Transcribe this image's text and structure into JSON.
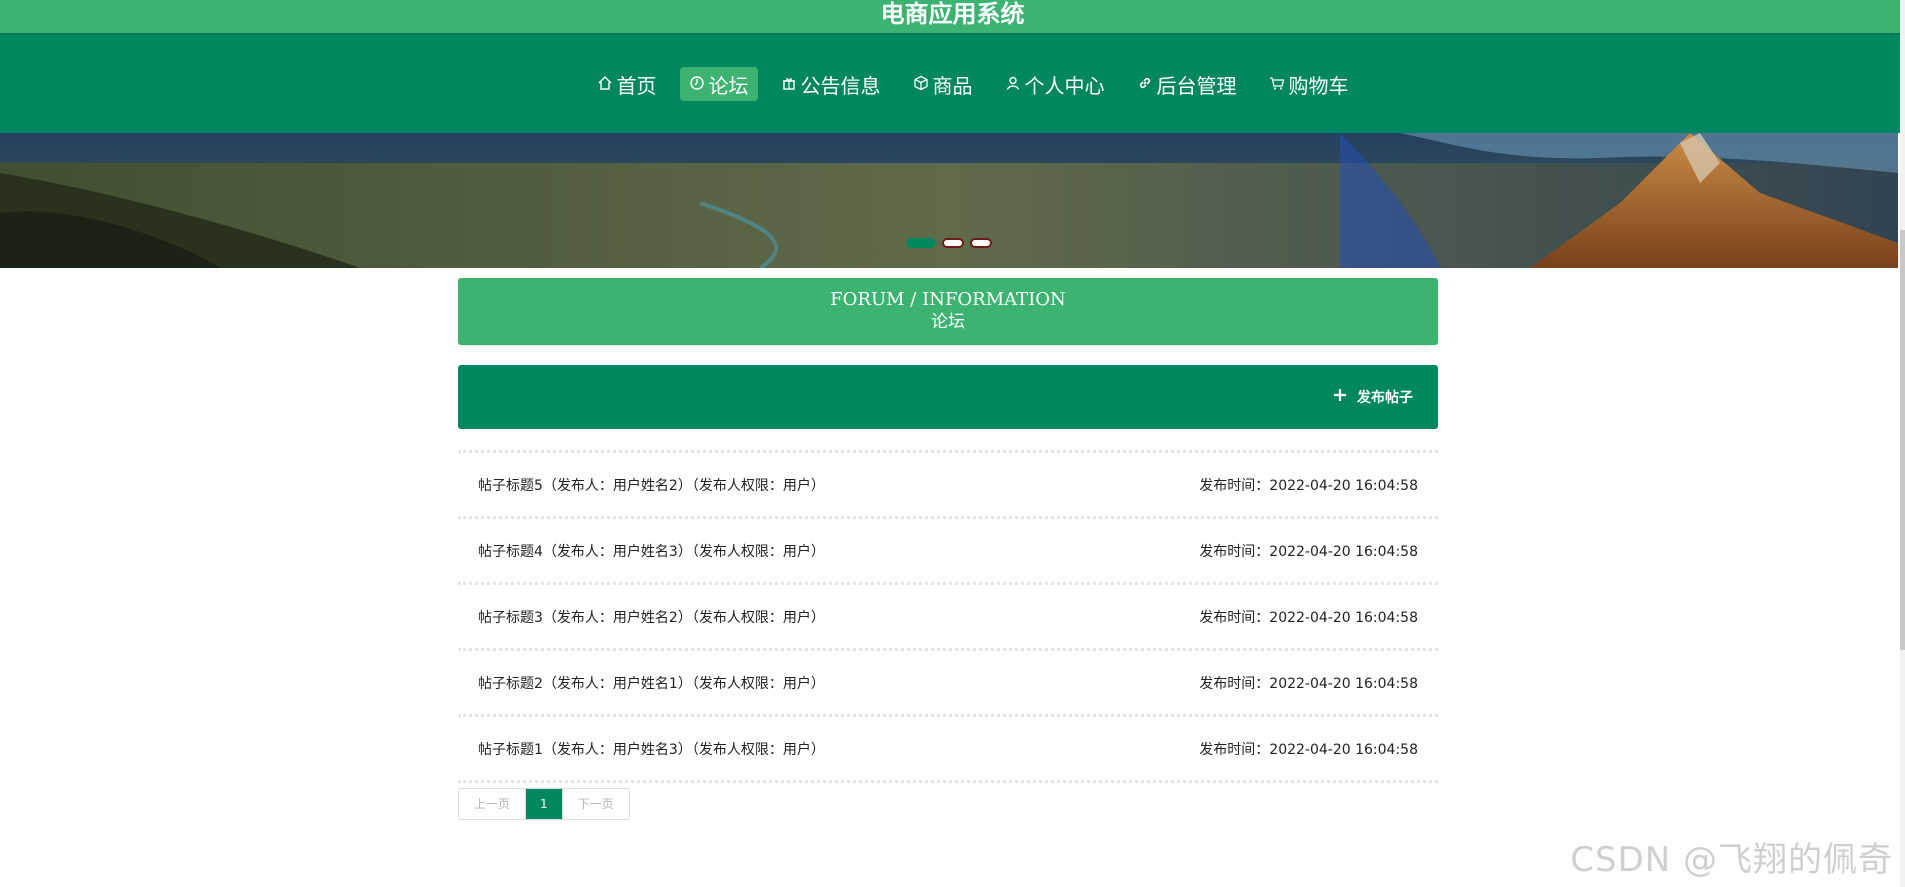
{
  "app": {
    "title": "电商应用系统"
  },
  "nav": {
    "items": [
      {
        "label": "首页",
        "icon": "home-icon"
      },
      {
        "label": "论坛",
        "icon": "clock-icon",
        "active": true
      },
      {
        "label": "公告信息",
        "icon": "gift-icon"
      },
      {
        "label": "商品",
        "icon": "box-icon"
      },
      {
        "label": "个人中心",
        "icon": "user-icon"
      },
      {
        "label": "后台管理",
        "icon": "link-icon"
      },
      {
        "label": "购物车",
        "icon": "cart-icon"
      }
    ]
  },
  "banner": {
    "active_slide": 1,
    "slide_count": 3
  },
  "section": {
    "title_en": "FORUM / INFORMATION",
    "title_zh": "论坛"
  },
  "actions": {
    "add_post_label": "发布帖子",
    "add_post_icon": "plus-icon"
  },
  "posts": [
    {
      "title": "帖子标题5（发布人：用户姓名2）（发布人权限：用户）",
      "time": "发布时间：2022-04-20 16:04:58"
    },
    {
      "title": "帖子标题4（发布人：用户姓名3）（发布人权限：用户）",
      "time": "发布时间：2022-04-20 16:04:58"
    },
    {
      "title": "帖子标题3（发布人：用户姓名2）（发布人权限：用户）",
      "time": "发布时间：2022-04-20 16:04:58"
    },
    {
      "title": "帖子标题2（发布人：用户姓名1）（发布人权限：用户）",
      "time": "发布时间：2022-04-20 16:04:58"
    },
    {
      "title": "帖子标题1（发布人：用户姓名3）（发布人权限：用户）",
      "time": "发布时间：2022-04-20 16:04:58"
    }
  ],
  "pagination": {
    "prev": "上一页",
    "current": "1",
    "next": "下一页"
  },
  "watermark": "CSDN @飞翔的佩奇",
  "colors": {
    "primary": "#00875f",
    "accent": "#3cb371"
  }
}
